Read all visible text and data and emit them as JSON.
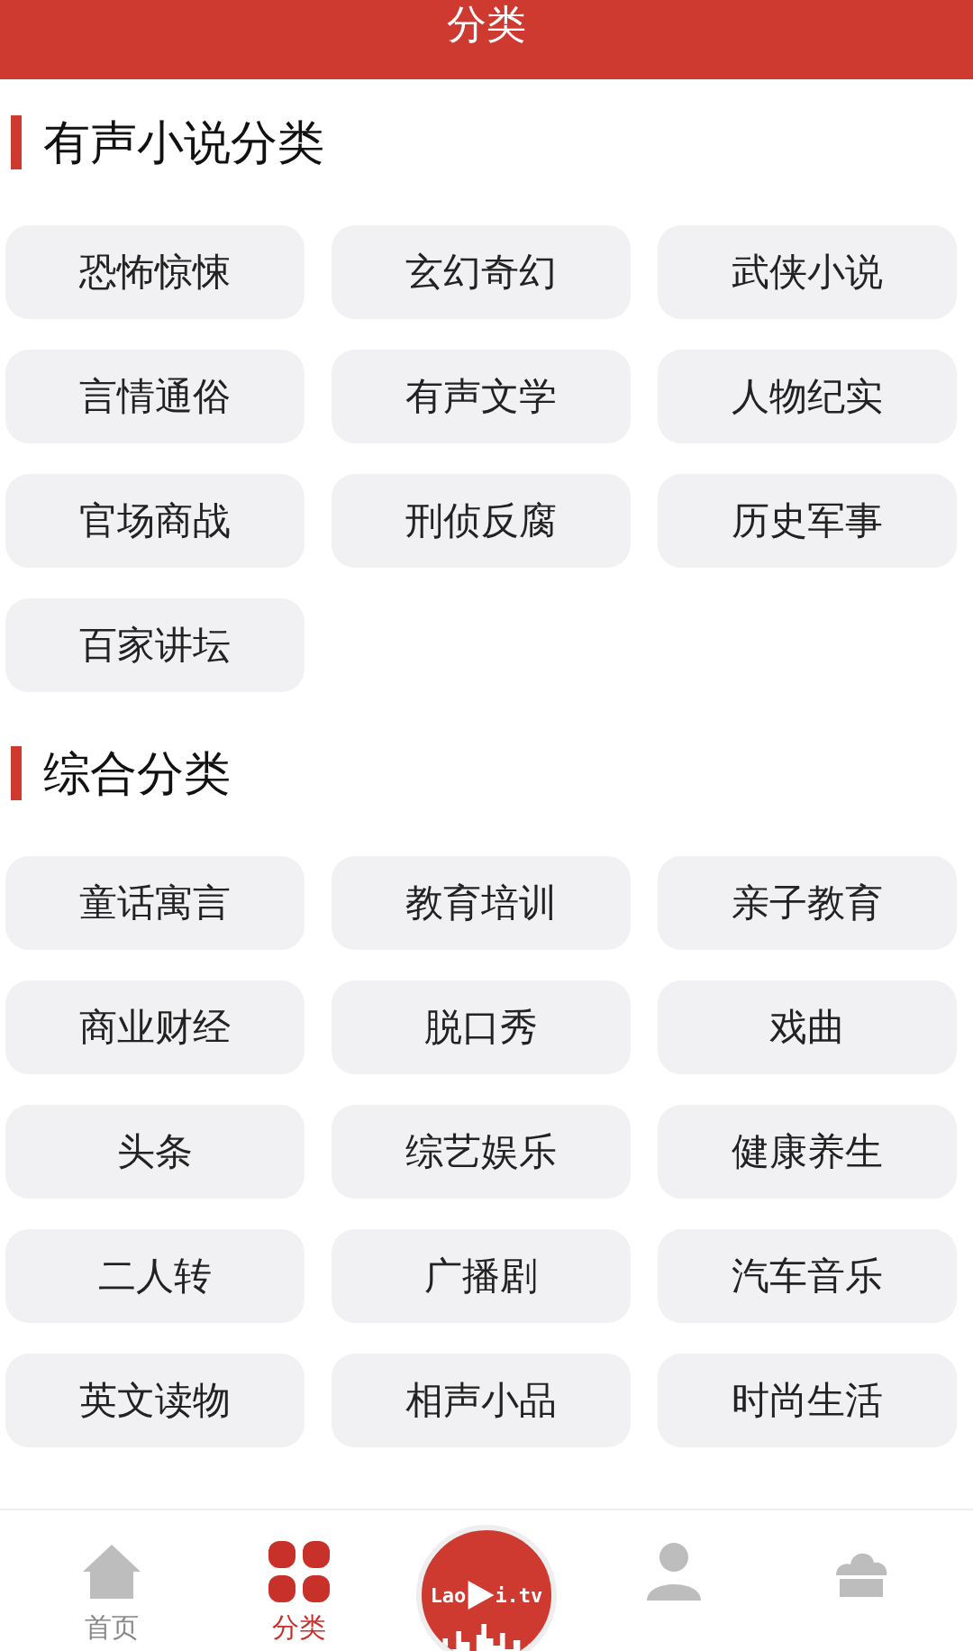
{
  "header": {
    "title": "分类"
  },
  "sections": [
    {
      "title": "有声小说分类",
      "items": [
        "恐怖惊悚",
        "玄幻奇幻",
        "武侠小说",
        "言情通俗",
        "有声文学",
        "人物纪实",
        "官场商战",
        "刑侦反腐",
        "历史军事",
        "百家讲坛"
      ]
    },
    {
      "title": "综合分类",
      "items": [
        "童话寓言",
        "教育培训",
        "亲子教育",
        "商业财经",
        "脱口秀",
        "戏曲",
        "头条",
        "综艺娱乐",
        "健康养生",
        "二人转",
        "广播剧",
        "汽车音乐",
        "英文读物",
        "相声小品",
        "时尚生活"
      ]
    }
  ],
  "nav": [
    {
      "kind": "home",
      "label": "首页",
      "selected": false
    },
    {
      "kind": "grid",
      "label": "分类",
      "selected": true
    },
    {
      "kind": "player",
      "logo_start": "Lao",
      "logo_end": "i.tv"
    },
    {
      "kind": "person",
      "selected": false
    },
    {
      "kind": "cloud",
      "selected": false
    }
  ]
}
